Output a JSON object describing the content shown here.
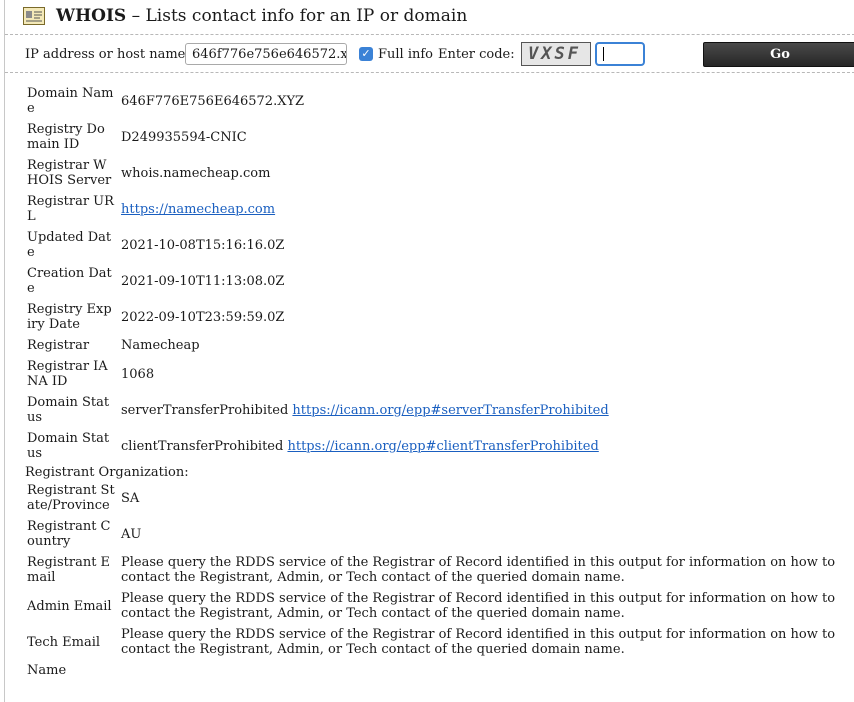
{
  "header": {
    "icon": "id-card-icon",
    "title_bold": "WHOIS",
    "title_rest": " – Lists contact info for an IP or domain"
  },
  "form": {
    "ip_label": "IP address or host name:",
    "ip_value": "646f776e756e646572.x",
    "full_info_label": "Full info",
    "full_info_checked": true,
    "code_label": "Enter code:",
    "captcha_text": "VXSF",
    "go_label": "Go"
  },
  "records": [
    {
      "key": "Domain Name",
      "value": "646F776E756E646572.XYZ"
    },
    {
      "key": "Registry Domain ID",
      "value": "D249935594-CNIC"
    },
    {
      "key": "Registrar WHOIS Server",
      "value": "whois.namecheap.com"
    },
    {
      "key": "Registrar URL",
      "link": "https://namecheap.com"
    },
    {
      "key": "Updated Date",
      "value": "2021-10-08T15:16:16.0Z"
    },
    {
      "key": "Creation Date",
      "value": "2021-09-10T11:13:08.0Z"
    },
    {
      "key": "Registry Expiry Date",
      "value": "2022-09-10T23:59:59.0Z"
    },
    {
      "key": "Registrar",
      "value": "Namecheap"
    },
    {
      "key": "Registrar IANA ID",
      "value": "1068"
    },
    {
      "key": "Domain Status",
      "value": "serverTransferProhibited",
      "link": "https://icann.org/epp#serverTransferProhibited"
    },
    {
      "key": "Domain Status",
      "value": "clientTransferProhibited",
      "link": "https://icann.org/epp#clientTransferProhibited"
    }
  ],
  "section_label": "Registrant Organization:",
  "records2": [
    {
      "key": "Registrant State/Province",
      "value": "SA"
    },
    {
      "key": "Registrant Country",
      "value": "AU"
    },
    {
      "key": "Registrant Email",
      "value": "Please query the RDDS service of the Registrar of Record identified in this output for information on how to contact the Registrant, Admin, or Tech contact of the queried domain name."
    },
    {
      "key": "Admin Email",
      "value": "Please query the RDDS service of the Registrar of Record identified in this output for information on how to contact the Registrant, Admin, or Tech contact of the queried domain name."
    },
    {
      "key": "Tech Email",
      "value": "Please query the RDDS service of the Registrar of Record identified in this output for information on how to contact the Registrant, Admin, or Tech contact of the queried domain name."
    },
    {
      "key": "Name",
      "value": ""
    }
  ]
}
